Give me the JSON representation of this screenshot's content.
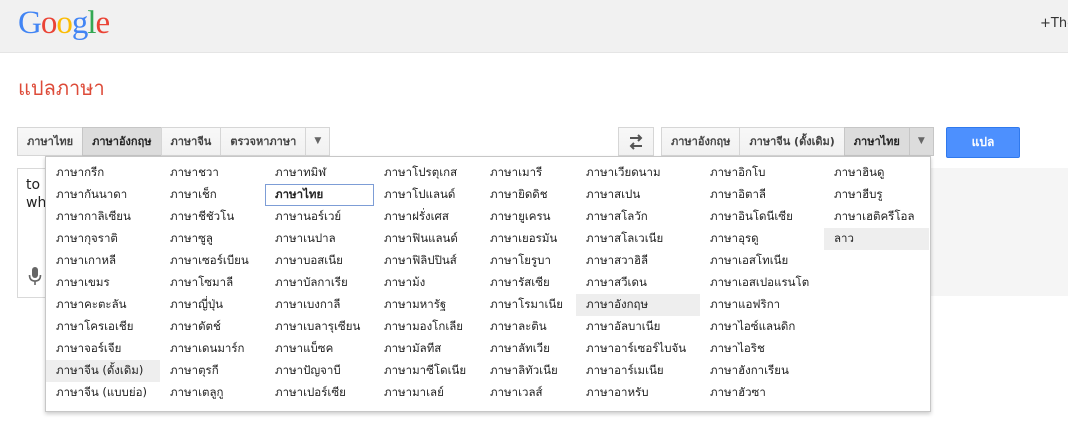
{
  "header": {
    "logo_letters": [
      "G",
      "o",
      "o",
      "g",
      "l",
      "e"
    ],
    "logo_colors": [
      "#4285f4",
      "#ea4335",
      "#fbbc05",
      "#4285f4",
      "#34a853",
      "#ea4335"
    ],
    "plus_link": "+The"
  },
  "page_title": "แปลภาษา",
  "source_langs": [
    "ภาษาไทย",
    "ภาษาอังกฤษ",
    "ภาษาจีน",
    "ตรวจหาภาษา"
  ],
  "source_active": 1,
  "target_langs": [
    "ภาษาอังกฤษ",
    "ภาษาจีน (ดั้งเดิม)",
    "ภาษาไทย"
  ],
  "target_active": 2,
  "translate_label": "แปล",
  "source_text": [
    "to",
    "wh"
  ],
  "dropdown_glyph": "▼",
  "menu_columns": [
    [
      "ภาษากรีก",
      "ภาษากันนาดา",
      "ภาษากาลิเซียน",
      "ภาษากุจราติ",
      "ภาษาเกาหลี",
      "ภาษาเขมร",
      "ภาษาคะตะลัน",
      "ภาษาโครเอเชีย",
      "ภาษาจอร์เจีย",
      "ภาษาจีน (ดั้งเดิม)",
      "ภาษาจีน (แบบย่อ)"
    ],
    [
      "ภาษาชวา",
      "ภาษาเช็ก",
      "ภาษาชีชัวโน",
      "ภาษาซูลู",
      "ภาษาเซอร์เบียน",
      "ภาษาโซมาลี",
      "ภาษาญี่ปุ่น",
      "ภาษาดัตช์",
      "ภาษาเดนมาร์ก",
      "ภาษาตุรกี",
      "ภาษาเตลูกู"
    ],
    [
      "ภาษาทมิฬ",
      "ภาษาไทย",
      "ภาษานอร์เวย์",
      "ภาษาเนปาล",
      "ภาษาบอสเนีย",
      "ภาษาบัลกาเรีย",
      "ภาษาเบงกาลี",
      "ภาษาเบลารุเซียน",
      "ภาษาแบ็ซค",
      "ภาษาปัญจาบี",
      "ภาษาเปอร์เซีย"
    ],
    [
      "ภาษาโปรตุเกส",
      "ภาษาโปแลนด์",
      "ภาษาฝรั่งเศส",
      "ภาษาฟินแลนด์",
      "ภาษาฟิลิปปินส์",
      "ภาษาม้ง",
      "ภาษามหารัฐ",
      "ภาษามองโกเลีย",
      "ภาษามัลทีส",
      "ภาษามาซีโดเนีย",
      "ภาษามาเลย์"
    ],
    [
      "ภาษาเมารี",
      "ภาษายิดดิช",
      "ภาษายูเครน",
      "ภาษาเยอรมัน",
      "ภาษาโยรูบา",
      "ภาษารัสเซีย",
      "ภาษาโรมาเนีย",
      "ภาษาละติน",
      "ภาษาลัทเวีย",
      "ภาษาลิทัวเนีย",
      "ภาษาเวลส์"
    ],
    [
      "ภาษาเวียดนาม",
      "ภาษาสเปน",
      "ภาษาสโลวัก",
      "ภาษาสโลเวเนีย",
      "ภาษาสวาฮิลี",
      "ภาษาสวีเดน",
      "ภาษาอังกฤษ",
      "ภาษาอัลบาเนีย",
      "ภาษาอาร์เซอร์ไบจัน",
      "ภาษาอาร์เมเนีย",
      "ภาษาอาหรับ"
    ],
    [
      "ภาษาอิกโบ",
      "ภาษาอิตาลี",
      "ภาษาอินโดนีเซีย",
      "ภาษาอุรดู",
      "ภาษาเอสโทเนีย",
      "ภาษาเอสเปอแรนโต",
      "ภาษาแอฟริกา",
      "ภาษาไอซ์แลนดิก",
      "ภาษาไอริช",
      "ภาษาฮังกาเรียน",
      "ภาษาฮัวซา"
    ],
    [
      "ภาษาฮินดู",
      "ภาษาฮีบรู",
      "ภาษาเฮติครีโอล",
      "ลาว"
    ]
  ]
}
